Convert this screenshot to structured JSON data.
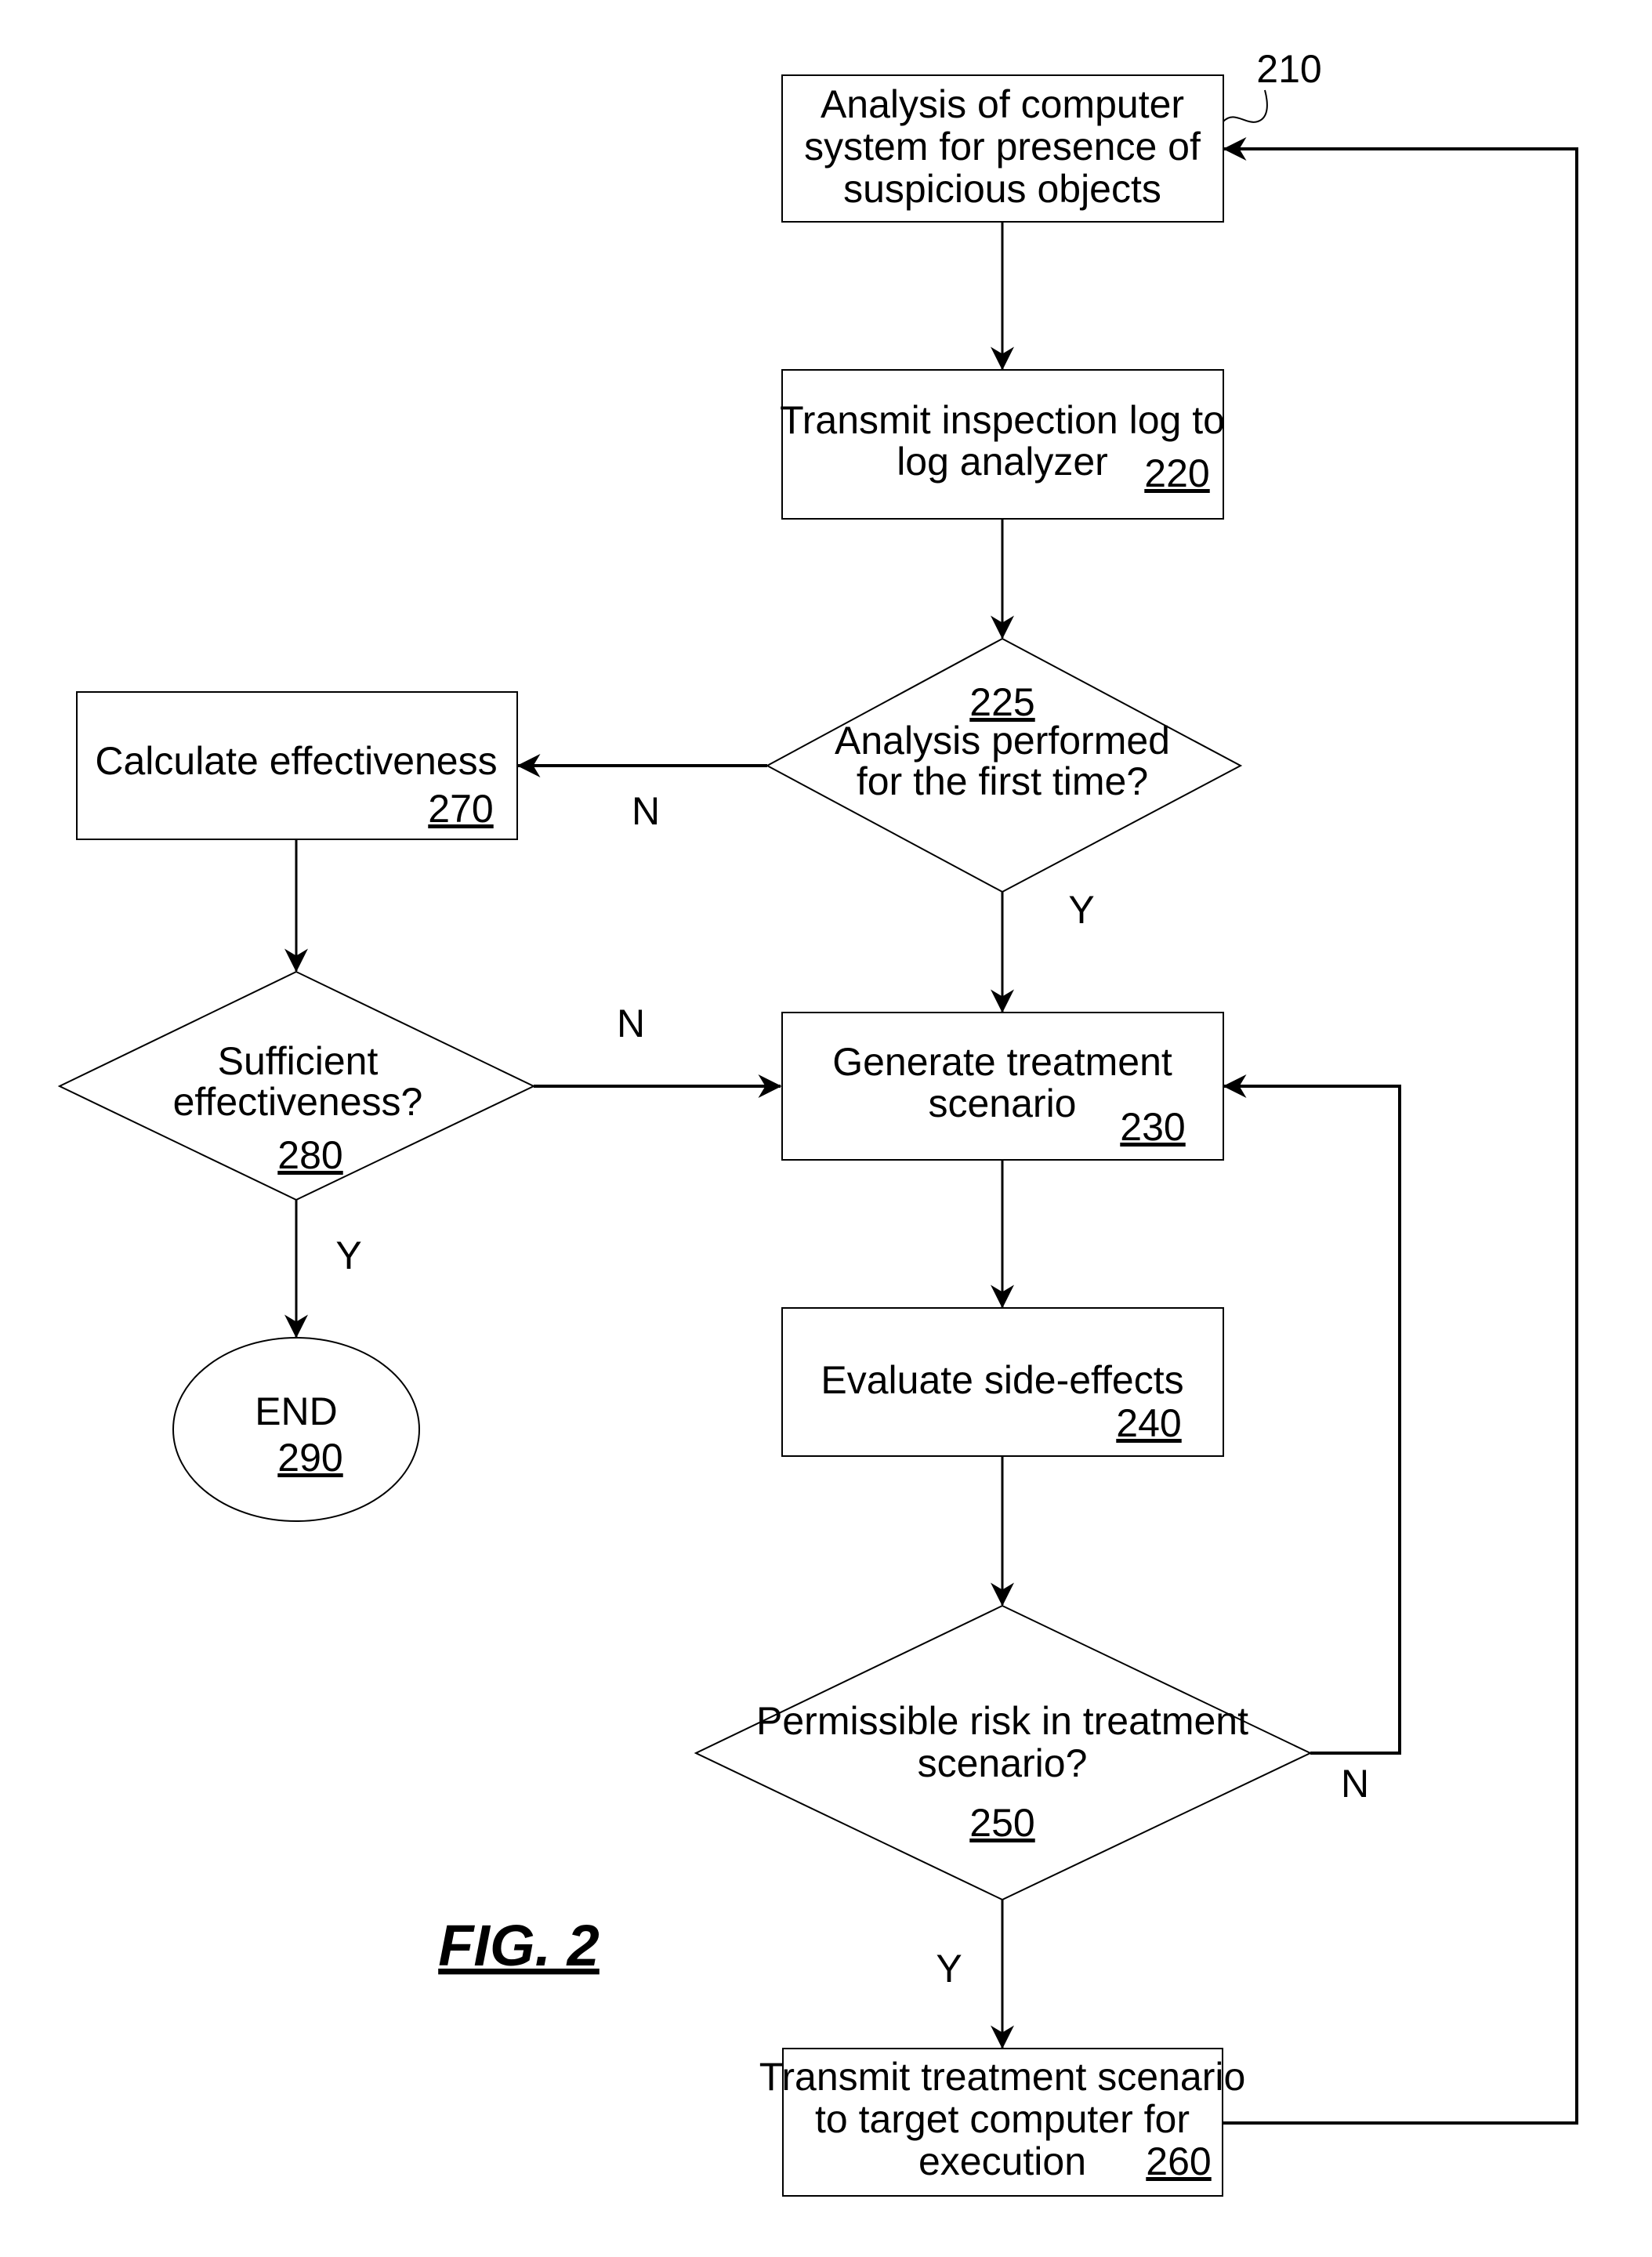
{
  "figure": {
    "caption": "FIG. 2"
  },
  "nodes": {
    "n210": {
      "ref": "210",
      "lines": [
        "Analysis of computer",
        "system for presence of",
        "suspicious objects"
      ]
    },
    "n220": {
      "ref": "220",
      "lines": [
        "Transmit inspection log to",
        "log analyzer"
      ]
    },
    "n225": {
      "ref": "225",
      "lines": [
        "Analysis performed",
        "for the first time?"
      ]
    },
    "n230": {
      "ref": "230",
      "lines": [
        "Generate treatment",
        "scenario"
      ]
    },
    "n240": {
      "ref": "240",
      "lines": [
        "Evaluate side-effects"
      ]
    },
    "n250": {
      "ref": "250",
      "lines": [
        "Permissible risk in treatment",
        "scenario?"
      ]
    },
    "n260": {
      "ref": "260",
      "lines": [
        "Transmit treatment scenario",
        "to target computer for",
        "execution"
      ]
    },
    "n270": {
      "ref": "270",
      "lines": [
        "Calculate effectiveness"
      ]
    },
    "n280": {
      "ref": "280",
      "lines": [
        "Sufficient",
        "effectiveness?"
      ]
    },
    "n290": {
      "ref": "290",
      "lines": [
        "END"
      ]
    }
  },
  "edges": {
    "e225_no": "N",
    "e225_yes": "Y",
    "e280_no": "N",
    "e280_yes": "Y",
    "e250_no": "N",
    "e250_yes": "Y"
  }
}
